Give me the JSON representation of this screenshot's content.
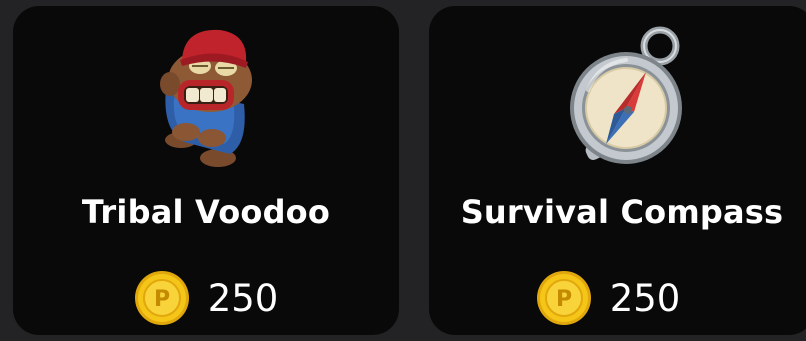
{
  "items": [
    {
      "name": "Tribal Voodoo",
      "price": "250",
      "icon": "tribal-voodoo-icon",
      "currency_icon": "coin-icon"
    },
    {
      "name": "Survival Compass",
      "price": "250",
      "icon": "survival-compass-icon",
      "currency_icon": "coin-icon"
    }
  ],
  "coin_symbol": "P",
  "colors": {
    "card_background": "#090909",
    "page_background": "#232326",
    "coin_gold": "#f5c518",
    "text": "#ffffff"
  }
}
